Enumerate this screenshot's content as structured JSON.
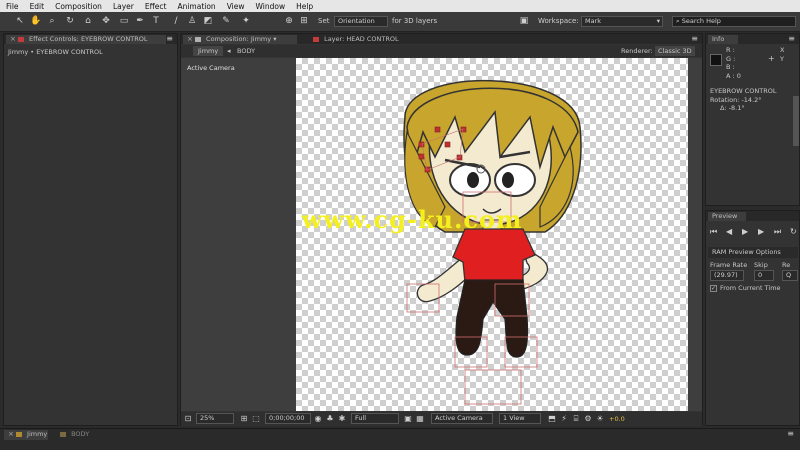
{
  "menu": [
    "File",
    "Edit",
    "Composition",
    "Layer",
    "Effect",
    "Animation",
    "View",
    "Window",
    "Help"
  ],
  "toolbar": {
    "set_label": "Set",
    "orientation_value": "Orientation",
    "for3d_label": "for 3D layers",
    "workspace_label": "Workspace:",
    "workspace_value": "Mark",
    "search_placeholder": "Search Help"
  },
  "effect_controls": {
    "tab_label": "Effect Controls: EYEBROW CONTROL",
    "path": "Jimmy • EYEBROW CONTROL"
  },
  "composition": {
    "tab_label": "Composition: Jimmy",
    "layer_tab_label": "Layer: HEAD CONTROL",
    "crumb_jimmy": "Jimmy",
    "crumb_body": "BODY",
    "renderer_label": "Renderer:",
    "renderer_value": "Classic 3D",
    "camera_label": "Active Camera",
    "watermark": "www.cg-ku.com",
    "footer": {
      "zoom": "25%",
      "timecode": "0;00;00;00",
      "resolution": "Full",
      "camera": "Active Camera",
      "view": "1 View",
      "exposure": "+0.0"
    }
  },
  "info": {
    "tab_label": "Info",
    "r": "R :",
    "g": "G :",
    "b": "B :",
    "a": "A : 0",
    "x": "X",
    "y": "Y",
    "layer_name": "EYEBROW CONTROL",
    "rotation": "Rotation: -14.2°",
    "delta": "Δ: -8.1°"
  },
  "preview": {
    "tab_label": "Preview",
    "ram_options": "RAM Preview Options",
    "frame_rate_label": "Frame Rate",
    "skip_label": "Skip",
    "res_label": "Re",
    "frame_rate_value": "(29.97)",
    "skip_value": "0",
    "res_value": "Q",
    "from_current_label": "From Current Time"
  },
  "timeline": {
    "tab_jimmy": "Jimmy",
    "tab_body": "BODY"
  },
  "colors": {
    "hair": "#c8a52c",
    "skin": "#f3ead0",
    "shirt": "#e02020",
    "pants": "#2b1a14",
    "watermark": "#f4ef1e",
    "accent_red": "#c43b3b"
  }
}
